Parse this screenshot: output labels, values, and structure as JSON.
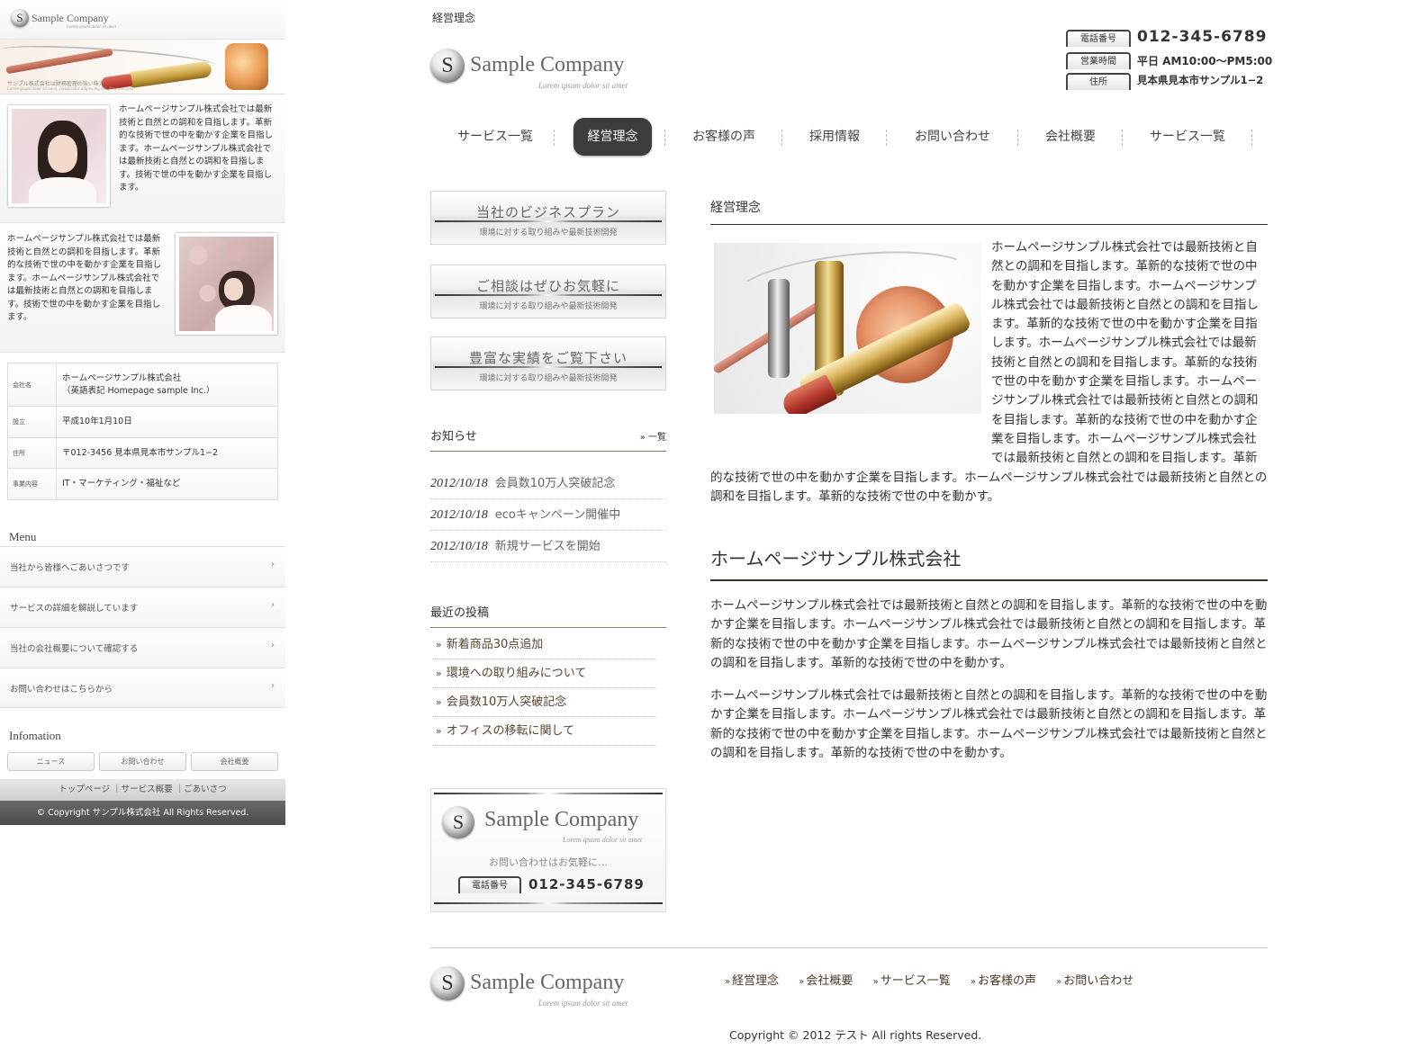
{
  "brand": {
    "name": "Sample Company",
    "tagline": "Lorem ipsum dolor sit amet",
    "mark_letter": "S"
  },
  "mobile": {
    "hero_caption": "サンプル株式会社は財務管理の強い味方",
    "hero_caption_sub": "Lorem ipsum dolor sit amet, consectetur adipiscing elit. Praesent quis",
    "intro1": "ホームページサンプル株式会社では最新技術と自然との調和を目指します。革新的な技術で世の中を動かす企業を目指します。ホームページサンプル株式会社では最新技術と自然との調和を目指します。技術で世の中を動かす企業を目指します。",
    "intro2": "ホームページサンプル株式会社では最新技術と自然との調和を目指します。革新的な技術で世の中を動かす企業を目指します。ホームページサンプル株式会社では最新技術と自然との調和を目指します。技術で世の中を動かす企業を目指します。",
    "company": [
      {
        "key": "会社名",
        "value": "ホームページサンプル株式会社",
        "value2": "（英語表記 Homepage sample Inc.）"
      },
      {
        "key": "設立",
        "value": "平成10年1月10日",
        "value2": ""
      },
      {
        "key": "住所",
        "value": "〒012-3456 見本県見本市サンプル1−2",
        "value2": ""
      },
      {
        "key": "事業内容",
        "value": "IT・マーケティング・福祉など",
        "value2": ""
      }
    ],
    "menu_title": "Menu",
    "menu": [
      "当社から皆様へごあいさつです",
      "サービスの詳細を解説しています",
      "当社の会社概要について確認する",
      "お問い合わせはこちらから"
    ],
    "menu_arrow": "›",
    "info_title": "Infomation",
    "info_buttons": [
      "ニュース",
      "お問い合わせ",
      "会社概要"
    ],
    "footer_links": "トップページ ｜サービス概要 ｜ごあいさつ",
    "copyright": "© Copyright サンプル株式会社 All Rights Reserved."
  },
  "page_title": "経営理念",
  "contact": {
    "phone_label": "電話番号",
    "phone": "012-345-6789",
    "hours_label": "営業時間",
    "hours": "平日 AM10:00〜PM5:00",
    "address_label": "住所",
    "address": "見本県見本市サンプル1−2"
  },
  "nav": [
    {
      "label": "サービス一覧",
      "active": false
    },
    {
      "label": "経営理念",
      "active": true
    },
    {
      "label": "お客様の声",
      "active": false
    },
    {
      "label": "採用情報",
      "active": false
    },
    {
      "label": "お問い合わせ",
      "active": false
    },
    {
      "label": "会社概要",
      "active": false
    },
    {
      "label": "サービス一覧",
      "active": false
    }
  ],
  "banners": [
    {
      "title": "当社のビジネスプラン",
      "sub": "環境に対する取り組みや最新技術開発"
    },
    {
      "title": "ご相談はぜひお気軽に",
      "sub": "環境に対する取り組みや最新技術開発"
    },
    {
      "title": "豊富な実績をご覧下さい",
      "sub": "環境に対する取り組みや最新技術開発"
    }
  ],
  "news": {
    "title": "お知らせ",
    "more": "» 一覧",
    "items": [
      {
        "date": "2012/10/18",
        "text": "会員数10万人突破記念"
      },
      {
        "date": "2012/10/18",
        "text": "ecoキャンペーン開催中"
      },
      {
        "date": "2012/10/18",
        "text": "新規サービスを開始"
      }
    ]
  },
  "posts": {
    "title": "最近の投稿",
    "bullet": "»",
    "items": [
      "新着商品30点追加",
      "環境への取り組みについて",
      "会員数10万人突破記念",
      "オフィスの移転に関して"
    ]
  },
  "side_contact": {
    "note": "お問い合わせはお気軽に…",
    "phone_label": "電話番号",
    "phone": "012-345-6789"
  },
  "main": {
    "h1": "経営理念",
    "p1": "ホームページサンプル株式会社では最新技術と自然との調和を目指します。革新的な技術で世の中を動かす企業を目指します。ホームページサンプル株式会社では最新技術と自然との調和を目指します。革新的な技術で世の中を動かす企業を目指します。ホームページサンプル株式会社では最新技術と自然との調和を目指します。革新的な技術で世の中を動かす企業を目指します。ホームページサンプル株式会社では最新技術と自然との調和を目指します。革新的な技術で世の中を動かす企業を目指します。ホームページサンプル株式会社では最新技術と自然との調和を目指します。革新的な技術で世の中を動かす企業を目指します。ホームページサンプル株式会社では最新技術と自然との調和を目指します。革新的な技術で世の中を動かす。",
    "h2": "ホームページサンプル株式会社",
    "p2": "ホームページサンプル株式会社では最新技術と自然との調和を目指します。革新的な技術で世の中を動かす企業を目指します。ホームページサンプル株式会社では最新技術と自然との調和を目指します。革新的な技術で世の中を動かす企業を目指します。ホームページサンプル株式会社では最新技術と自然との調和を目指します。革新的な技術で世の中を動かす。",
    "p3": "ホームページサンプル株式会社では最新技術と自然との調和を目指します。革新的な技術で世の中を動かす企業を目指します。ホームページサンプル株式会社では最新技術と自然との調和を目指します。革新的な技術で世の中を動かす企業を目指します。ホームページサンプル株式会社では最新技術と自然との調和を目指します。革新的な技術で世の中を動かす。"
  },
  "footer": {
    "links": [
      "経営理念",
      "会社概要",
      "サービス一覧",
      "お客様の声",
      "お問い合わせ"
    ],
    "link_prefix": "»",
    "copyright": "Copyright © 2012 テスト All rights Reserved."
  }
}
